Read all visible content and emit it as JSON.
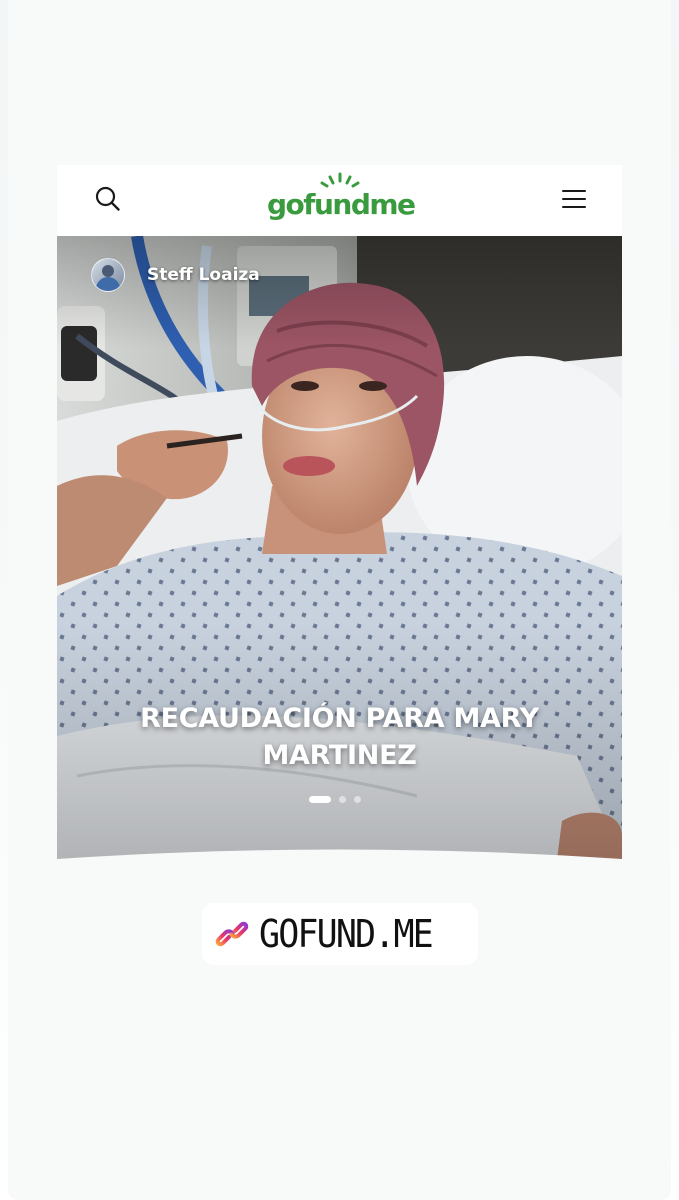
{
  "header": {
    "logo_text": "gofundme",
    "brand_color": "#3a9b3e",
    "search_icon": "search-icon",
    "menu_icon": "hamburger-menu-icon"
  },
  "campaign": {
    "author_name": "Steff Loaiza",
    "headline": "RECAUDACIÓN PARA MARY MARTINEZ",
    "carousel": {
      "total_slides": 3,
      "active_slide": 1
    }
  },
  "link_sticker": {
    "icon": "link-icon",
    "text": "GOFUND.ME"
  }
}
